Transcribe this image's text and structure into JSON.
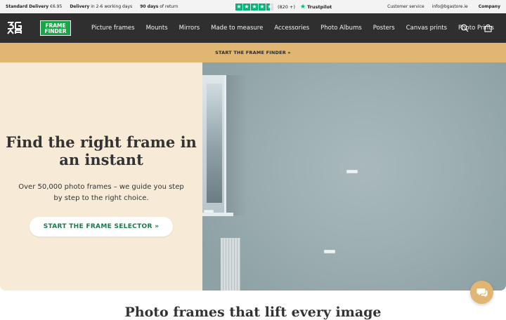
{
  "topbar": {
    "shipping_label": "Standard Delivery",
    "shipping_price": "€6.95",
    "delivery_label": "Delivery",
    "delivery_time": "in 2-6 working days",
    "return_days": "90 days",
    "return_label": "of return",
    "rating_count": "(820 +)",
    "trustpilot": "Trustpilot",
    "customer_service": "Customer service",
    "email": "info@bgastore.ie",
    "company": "Company"
  },
  "brand": {
    "frame_finder_line1": "FRAME",
    "frame_finder_line2": "FINDER"
  },
  "nav": {
    "items": [
      {
        "label": "Picture frames"
      },
      {
        "label": "Mounts"
      },
      {
        "label": "Mirrors"
      },
      {
        "label": "Made to measure"
      },
      {
        "label": "Accessories"
      },
      {
        "label": "Photo Albums"
      },
      {
        "label": "Posters"
      },
      {
        "label": "Canvas prints"
      },
      {
        "label": "Photo Prints"
      }
    ]
  },
  "promo": {
    "text": "START THE FRAME FINDER »"
  },
  "hero": {
    "title": "Find the right frame in an instant",
    "subtitle": "Over 50,000 photo frames – we guide you step by step to the right choice.",
    "cta": "START THE FRAME SELECTOR »"
  },
  "section": {
    "title": "Photo frames that lift every image"
  },
  "colors": {
    "accent_gold": "#e0b672",
    "nav_bg": "#2f2f2f",
    "trustpilot_green": "#00b67a",
    "frame_finder_green": "#1aa546",
    "cta_text": "#167a4c",
    "hero_cream": "#f7ead7"
  },
  "icons": {
    "search": "search-icon",
    "bag": "shopping-bag-icon",
    "chat": "chat-icon"
  }
}
